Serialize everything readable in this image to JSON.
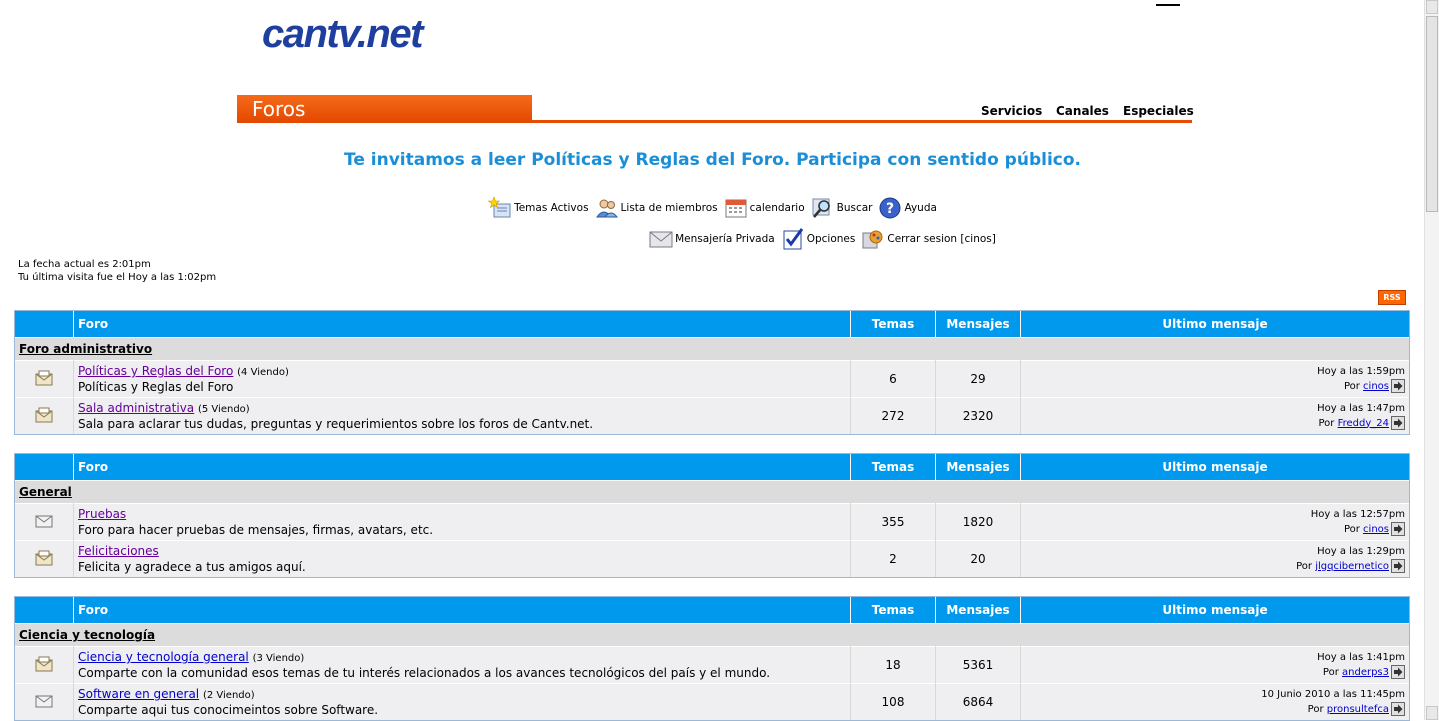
{
  "header": {
    "logo": "cantv.net",
    "section_tab": "Foros",
    "nav": [
      "Servicios",
      "Canales",
      "Especiales"
    ]
  },
  "banner": "Te invitamos a leer Políticas y Reglas del Foro. Participa con sentido público.",
  "toolbar": {
    "row1": [
      {
        "label": "Temas Activos",
        "icon": "active-topics-icon"
      },
      {
        "label": "Lista de miembros",
        "icon": "members-icon"
      },
      {
        "label": "calendario",
        "icon": "calendar-icon"
      },
      {
        "label": "Buscar",
        "icon": "search-icon"
      },
      {
        "label": "Ayuda",
        "icon": "help-icon"
      }
    ],
    "row2": [
      {
        "label": "Mensajería Privada",
        "icon": "private-message-icon"
      },
      {
        "label": "Opciones",
        "icon": "options-icon"
      },
      {
        "label": "Cerrar sesion [cinos]",
        "icon": "logout-icon"
      }
    ]
  },
  "date_info": {
    "current": "La fecha actual es 2:01pm",
    "last_visit": "Tu última visita fue el Hoy a las 1:02pm"
  },
  "rss_label": "RSS",
  "columns": {
    "forum": "Foro",
    "topics": "Temas",
    "posts": "Mensajes",
    "last_post": "Ultimo mensaje"
  },
  "sections": [
    {
      "category": "Foro administrativo",
      "forums": [
        {
          "name": "Políticas y Reglas del Foro",
          "viewing": "(4 Viendo)",
          "desc": "Políticas y Reglas del Foro",
          "topics": "6",
          "posts": "29",
          "last_time": "Hoy a las 1:59pm",
          "by": "Por",
          "last_user": "cinos"
        },
        {
          "name": "Sala administrativa",
          "viewing": "(5 Viendo)",
          "desc": "Sala para aclarar tus dudas, preguntas y requerimientos sobre los foros de Cantv.net.",
          "topics": "272",
          "posts": "2320",
          "last_time": "Hoy a las 1:47pm",
          "by": "Por",
          "last_user": "Freddy_24"
        }
      ]
    },
    {
      "category": "General",
      "forums": [
        {
          "name": "Pruebas",
          "viewing": "",
          "desc": "Foro para hacer pruebas de mensajes, firmas, avatars, etc.",
          "topics": "355",
          "posts": "1820",
          "last_time": "Hoy a las 12:57pm",
          "by": "Por",
          "last_user": "cinos"
        },
        {
          "name": "Felicitaciones",
          "viewing": "",
          "desc": "Felicita y agradece a tus amigos aquí.",
          "topics": "2",
          "posts": "20",
          "last_time": "Hoy a las 1:29pm",
          "by": "Por",
          "last_user": "jlgqcibernetico"
        }
      ]
    },
    {
      "category": "Ciencia y tecnología",
      "forums": [
        {
          "name": "Ciencia y tecnología general",
          "viewing": "(3 Viendo)",
          "desc": "Comparte con la comunidad esos temas de tu interés relacionados a los avances tecnológicos del país y el mundo.",
          "topics": "18",
          "posts": "5361",
          "last_time": "Hoy a las 1:41pm",
          "by": "Por",
          "last_user": "anderps3"
        },
        {
          "name": "Software en general",
          "viewing": "(2 Viendo)",
          "desc": "Comparte aqui tus conocimeintos sobre Software.",
          "topics": "108",
          "posts": "6864",
          "last_time": "10 Junio 2010 a las 11:45pm",
          "by": "Por",
          "last_user": "pronsultefca"
        }
      ]
    }
  ]
}
